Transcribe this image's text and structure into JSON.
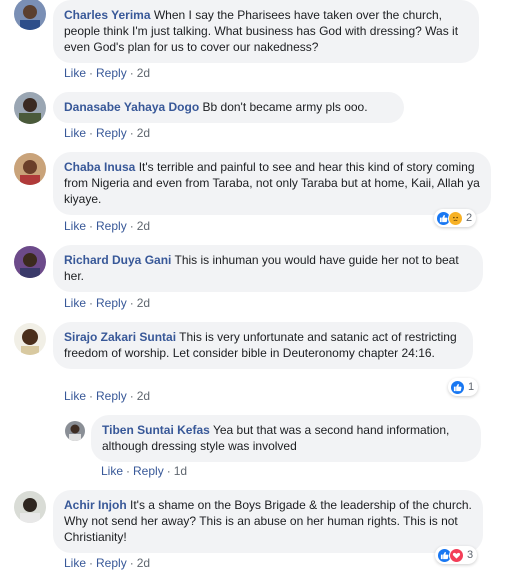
{
  "comments": [
    {
      "author": "Charles Yerima",
      "text": "When I say the Pharisees have taken over the church, people think I'm just talking. What business has God with dressing? Was it even God's plan for us to cover our nakedness?",
      "like": "Like",
      "reply": "Reply",
      "time": "2d"
    },
    {
      "author": "Danasabe Yahaya Dogo",
      "text": "Bb don't became army pls ooo.",
      "like": "Like",
      "reply": "Reply",
      "time": "2d"
    },
    {
      "author": "Chaba Inusa",
      "text": "It's terrible and painful to see and hear this kind of story coming from Nigeria and even from Taraba, not only Taraba but at home, Kaii, Allah ya kiyaye.",
      "like": "Like",
      "reply": "Reply",
      "time": "2d",
      "reactions": {
        "icons": [
          "like-icon",
          "sad-icon"
        ],
        "count": "2"
      }
    },
    {
      "author": "Richard Duya Gani",
      "text": "This is inhuman you would have guide her not to beat her.",
      "like": "Like",
      "reply": "Reply",
      "time": "2d"
    },
    {
      "author": "Sirajo Zakari Suntai",
      "text": "This is very unfortunate and satanic act of restricting freedom of worship. Let consider bible in Deuteronomy chapter 24:16.",
      "like": "Like",
      "reply": "Reply",
      "time": "2d",
      "reactions": {
        "icons": [
          "like-icon"
        ],
        "count": "1"
      }
    },
    {
      "author": "Tiben Suntai Kefas",
      "text": "Yea but that was a second hand information, although dressing style was involved",
      "like": "Like",
      "reply": "Reply",
      "time": "1d",
      "is_reply": true
    },
    {
      "author": "Achir Injoh",
      "text": "It's a shame on the Boys Brigade & the leadership of the church. Why not send her away? This is an abuse on her human rights. This is not Christianity!",
      "like": "Like",
      "reply": "Reply",
      "time": "2d",
      "reactions": {
        "icons": [
          "like-icon",
          "love-icon"
        ],
        "count": "3"
      }
    }
  ],
  "colors": {
    "link": "#385898",
    "bubble": "#f2f3f5",
    "meta": "#606770",
    "like": "#1877f2",
    "sad": "#f7b125",
    "love": "#f33e58"
  }
}
